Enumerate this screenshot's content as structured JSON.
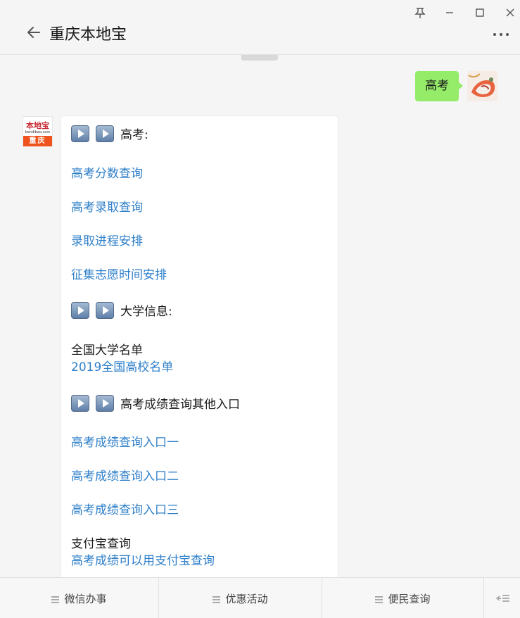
{
  "header": {
    "title": "重庆本地宝"
  },
  "conversation": {
    "user_message": "高考",
    "bot_avatar": {
      "logo_text": "本地宝",
      "site_text": "bendibao.com",
      "city_text": "重庆"
    },
    "reply": {
      "section_gaokao": "高考:",
      "links_gaokao": [
        "高考分数查询",
        "高考录取查询",
        "录取进程安排",
        "征集志愿时间安排"
      ],
      "section_university": "大学信息:",
      "university_label": "全国大学名单",
      "university_link": "2019全国高校名单",
      "section_other": "高考成绩查询其他入口",
      "links_other": [
        "高考成绩查询入口一",
        "高考成绩查询入口二",
        "高考成绩查询入口三"
      ],
      "alipay_label": "支付宝查询",
      "alipay_link": "高考成绩可以用支付宝查询"
    }
  },
  "menu": {
    "items": [
      "微信办事",
      "优惠活动",
      "便民查询"
    ]
  },
  "colors": {
    "bubble_green": "#95ec69",
    "link_blue": "#2e7fc9",
    "brand_orange": "#f0541e"
  }
}
